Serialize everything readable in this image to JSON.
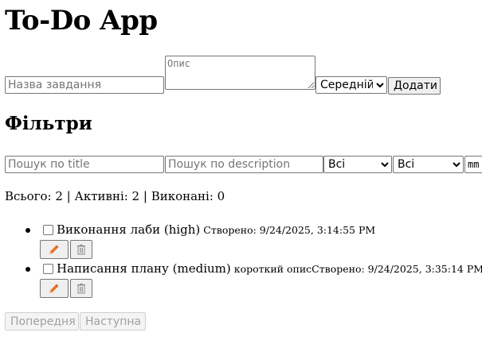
{
  "app": {
    "title": "To-Do App"
  },
  "form": {
    "title_placeholder": "Назва завдання",
    "description_placeholder": "Опис",
    "priority_selected": "Середній",
    "add_label": "Додати"
  },
  "filters": {
    "heading": "Фільтри",
    "search_title_placeholder": "Пошук по title",
    "search_description_placeholder": "Пошук по description",
    "status_selected": "Всі",
    "priority_selected": "Всі",
    "date_field_partial": "mm"
  },
  "stats": {
    "text": "Всього: 2 | Активні: 2 | Виконані: 0"
  },
  "tasks": [
    {
      "title": "Виконання лаби (high)",
      "description": "",
      "created": "Створено: 9/24/2025, 3:14:55 PM",
      "completed": false
    },
    {
      "title": "Написання плану (medium)",
      "description": "короткий опис",
      "created": "Створено: 9/24/2025, 3:35:14 PM",
      "completed": false
    }
  ],
  "pagination": {
    "prev_label": "Попередня",
    "next_label": "Наступна"
  },
  "colors": {
    "edit_icon": "#e8702a",
    "disabled_text": "#a0a0a0"
  },
  "icons": {
    "edit": "pencil-icon",
    "delete": "trash-icon"
  }
}
